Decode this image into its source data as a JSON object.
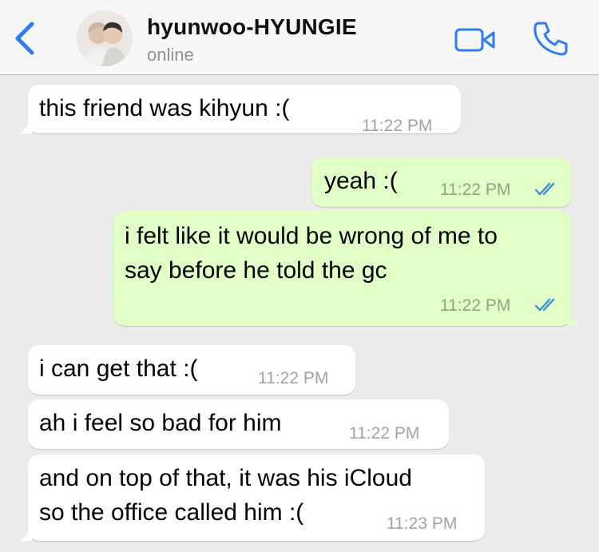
{
  "header": {
    "contact_name": "hyunwoo-HYUNGIE",
    "status": "online",
    "icons": {
      "back": "chevron-left-icon",
      "video": "video-camera-icon",
      "call": "phone-icon"
    },
    "accent_color": "#2f7bf5"
  },
  "messages": [
    {
      "direction": "incoming",
      "lines": [
        "this friend was kihyun :("
      ],
      "time": "11:22 PM"
    },
    {
      "direction": "outgoing",
      "lines": [
        "yeah :("
      ],
      "time": "11:22 PM",
      "read": true
    },
    {
      "direction": "outgoing",
      "lines": [
        "i felt like it would be wrong of me to",
        "say before he told the gc"
      ],
      "time": "11:22 PM",
      "read": true
    },
    {
      "direction": "incoming",
      "lines": [
        "i can get that :("
      ],
      "time": "11:22 PM"
    },
    {
      "direction": "incoming",
      "lines": [
        "ah i feel so bad for him"
      ],
      "time": "11:22 PM"
    },
    {
      "direction": "incoming",
      "lines": [
        "and on top of that, it was his iCloud",
        "so the office called him :("
      ],
      "time": "11:23 PM"
    }
  ]
}
